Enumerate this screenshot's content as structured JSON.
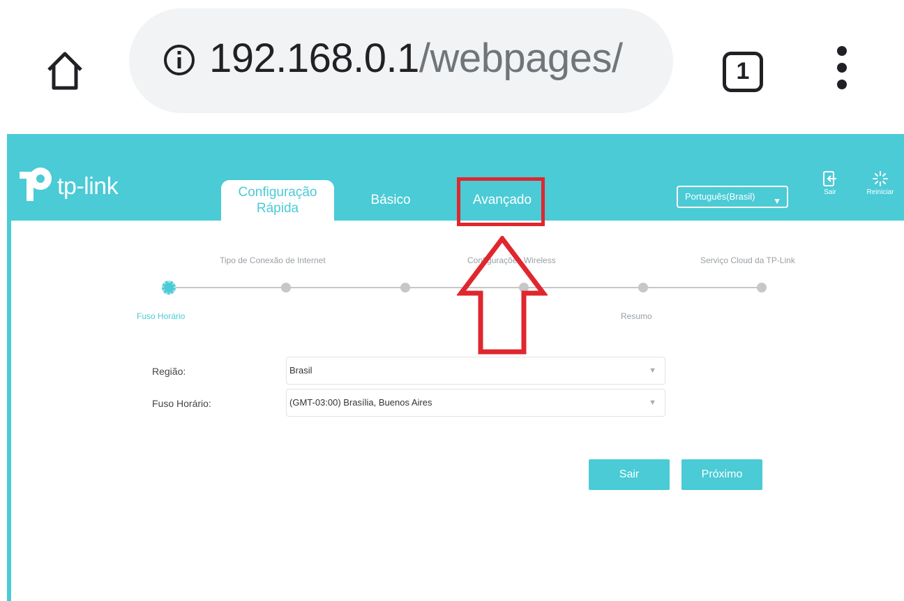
{
  "browser": {
    "url_host": "192.168.0.1",
    "url_path": "/webpages/",
    "tab_count": "1"
  },
  "header": {
    "logo_text": "tp-link",
    "tabs": [
      {
        "label_line1": "Configuração",
        "label_line2": "Rápida"
      },
      {
        "label": "Básico"
      },
      {
        "label": "Avançado"
      }
    ],
    "language": "Português(Brasil)",
    "exit_label": "Sair",
    "reboot_label": "Reiniciar"
  },
  "stepper": {
    "top_labels": [
      "Tipo de Conexão de Internet",
      "Configurações Wireless",
      "Serviço Cloud da TP-Link"
    ],
    "bottom_labels": [
      "Fuso Horário",
      "Resumo"
    ]
  },
  "form": {
    "region_label": "Região:",
    "region_value": "Brasil",
    "timezone_label": "Fuso Horário:",
    "timezone_value": "(GMT-03:00) Brasília, Buenos Aires"
  },
  "buttons": {
    "exit": "Sair",
    "next": "Próximo"
  },
  "colors": {
    "accent": "#4acbd6",
    "annotation": "#e0262e"
  }
}
